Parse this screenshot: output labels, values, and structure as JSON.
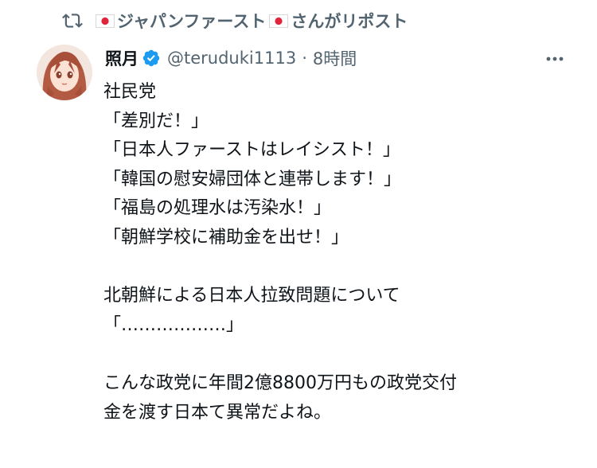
{
  "repost": {
    "account_name": "ジャパンファースト",
    "suffix": "さんがリポスト",
    "icon": "repost-icon",
    "flag_icon": "japan-flag-icon"
  },
  "tweet": {
    "display_name": "照月",
    "verified_icon": "verified-badge-icon",
    "handle": "@teruduki1113",
    "separator": "·",
    "time": "8時間",
    "more_icon": "more-options-icon",
    "lines": [
      "社民党",
      "「差別だ！」",
      "「日本人ファーストはレイシスト！」",
      "「韓国の慰安婦団体と連帯します！」",
      "「福島の処理水は汚染水！」",
      "「朝鮮学校に補助金を出せ！」",
      "",
      "北朝鮮による日本人拉致問題について",
      "「………………」",
      "",
      "こんな政党に年間2億8800万円もの政党交付",
      "金を渡す日本て異常だよね。"
    ]
  },
  "colors": {
    "text": "#0f1419",
    "secondary": "#536471",
    "verified_blue": "#1d9bf0",
    "flag_red": "#e0243a"
  }
}
